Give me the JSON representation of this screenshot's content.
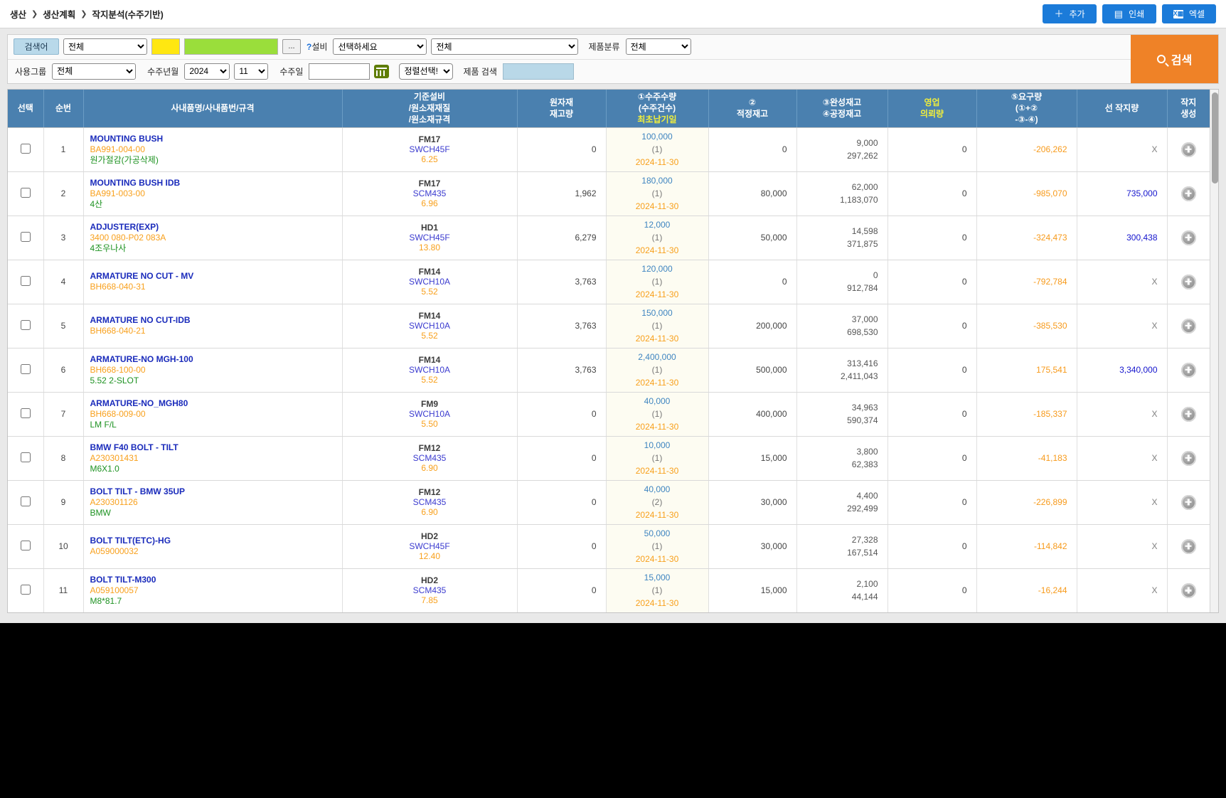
{
  "breadcrumb": {
    "items": [
      "생산",
      "생산계획",
      "작지분석(수주기반)"
    ]
  },
  "toolbar": {
    "add_label": "추가",
    "print_label": "인쇄",
    "excel_label": "엑셀"
  },
  "filters": {
    "keyword_label": "검색어",
    "keyword_type_value": "전체",
    "ellipsis_label": "...",
    "help_mark": "?",
    "equipment_label": "설비",
    "equipment_value": "선택하세요",
    "line_value": "전체",
    "product_class_label": "제품분류",
    "product_class_value": "전체",
    "usergroup_label": "사용그룹",
    "usergroup_value": "전체",
    "order_ym_label": "수주년월",
    "order_year_value": "2024",
    "order_month_value": "11",
    "order_date_label": "수주일",
    "order_date_value": "",
    "sort_value": "정렬선택!",
    "product_search_label": "제품 검색",
    "product_search_value": "",
    "search_button_label": "검색"
  },
  "columns": {
    "select": "선택",
    "seq": "순번",
    "item": "사내품명/사내품번/규격",
    "equip_l1": "기준설비",
    "equip_l2": "/원소재재질",
    "equip_l3": "/원소재규격",
    "raw_l1": "원자재",
    "raw_l2": "재고량",
    "order_l1": "①수주수량",
    "order_l2": "(수주건수)",
    "order_l3": "최초납기일",
    "proper_l1": "②",
    "proper_l2": "적정재고",
    "stock_l1": "③완성재고",
    "stock_l2": "④공정재고",
    "sales_l1": "영업",
    "sales_l2": "의뢰량",
    "req_l1": "⑤요구량",
    "req_l2": "(①+②",
    "req_l3": "-③-④)",
    "pre_work": "선 작지량",
    "gen_l1": "작지",
    "gen_l2": "생성"
  },
  "rows": [
    {
      "num": "1",
      "name": "MOUNTING BUSH",
      "part_no": "BA991-004-00",
      "spec": "원가절감(가공삭제)",
      "equipment": "FM17",
      "material": "SWCH45F",
      "material_spec": "6.25",
      "raw_stock": "0",
      "order_qty": "100,000",
      "order_count": "(1)",
      "due_date": "2024-11-30",
      "proper_stock": "0",
      "finished_stock": "9,000",
      "process_stock": "297,262",
      "sales_request": "0",
      "required_qty": "-206,262",
      "pre_work_qty": "X"
    },
    {
      "num": "2",
      "name": "MOUNTING BUSH IDB",
      "part_no": "BA991-003-00",
      "spec": "4산",
      "equipment": "FM17",
      "material": "SCM435",
      "material_spec": "6.96",
      "raw_stock": "1,962",
      "order_qty": "180,000",
      "order_count": "(1)",
      "due_date": "2024-11-30",
      "proper_stock": "80,000",
      "finished_stock": "62,000",
      "process_stock": "1,183,070",
      "sales_request": "0",
      "required_qty": "-985,070",
      "pre_work_qty": "735,000"
    },
    {
      "num": "3",
      "name": "ADJUSTER(EXP)",
      "part_no": "3400 080-P02 083A",
      "spec": "4조우나사",
      "equipment": "HD1",
      "material": "SWCH45F",
      "material_spec": "13.80",
      "raw_stock": "6,279",
      "order_qty": "12,000",
      "order_count": "(1)",
      "due_date": "2024-11-30",
      "proper_stock": "50,000",
      "finished_stock": "14,598",
      "process_stock": "371,875",
      "sales_request": "0",
      "required_qty": "-324,473",
      "pre_work_qty": "300,438"
    },
    {
      "num": "4",
      "name": "ARMATURE NO CUT - MV",
      "part_no": "BH668-040-31",
      "spec": "",
      "equipment": "FM14",
      "material": "SWCH10A",
      "material_spec": "5.52",
      "raw_stock": "3,763",
      "order_qty": "120,000",
      "order_count": "(1)",
      "due_date": "2024-11-30",
      "proper_stock": "0",
      "finished_stock": "0",
      "process_stock": "912,784",
      "sales_request": "0",
      "required_qty": "-792,784",
      "pre_work_qty": "X"
    },
    {
      "num": "5",
      "name": "ARMATURE NO CUT-IDB",
      "part_no": "BH668-040-21",
      "spec": "",
      "equipment": "FM14",
      "material": "SWCH10A",
      "material_spec": "5.52",
      "raw_stock": "3,763",
      "order_qty": "150,000",
      "order_count": "(1)",
      "due_date": "2024-11-30",
      "proper_stock": "200,000",
      "finished_stock": "37,000",
      "process_stock": "698,530",
      "sales_request": "0",
      "required_qty": "-385,530",
      "pre_work_qty": "X"
    },
    {
      "num": "6",
      "name": "ARMATURE-NO MGH-100",
      "part_no": "BH668-100-00",
      "spec": "5.52 2-SLOT",
      "equipment": "FM14",
      "material": "SWCH10A",
      "material_spec": "5.52",
      "raw_stock": "3,763",
      "order_qty": "2,400,000",
      "order_count": "(1)",
      "due_date": "2024-11-30",
      "proper_stock": "500,000",
      "finished_stock": "313,416",
      "process_stock": "2,411,043",
      "sales_request": "0",
      "required_qty": "175,541",
      "pre_work_qty": "3,340,000"
    },
    {
      "num": "7",
      "name": "ARMATURE-NO_MGH80",
      "part_no": "BH668-009-00",
      "spec": "LM F/L",
      "equipment": "FM9",
      "material": "SWCH10A",
      "material_spec": "5.50",
      "raw_stock": "0",
      "order_qty": "40,000",
      "order_count": "(1)",
      "due_date": "2024-11-30",
      "proper_stock": "400,000",
      "finished_stock": "34,963",
      "process_stock": "590,374",
      "sales_request": "0",
      "required_qty": "-185,337",
      "pre_work_qty": "X"
    },
    {
      "num": "8",
      "name": "BMW F40 BOLT - TILT",
      "part_no": "A230301431",
      "spec": "M6X1.0",
      "equipment": "FM12",
      "material": "SCM435",
      "material_spec": "6.90",
      "raw_stock": "0",
      "order_qty": "10,000",
      "order_count": "(1)",
      "due_date": "2024-11-30",
      "proper_stock": "15,000",
      "finished_stock": "3,800",
      "process_stock": "62,383",
      "sales_request": "0",
      "required_qty": "-41,183",
      "pre_work_qty": "X"
    },
    {
      "num": "9",
      "name": "BOLT TILT - BMW 35UP",
      "part_no": "A230301126",
      "spec": "BMW",
      "equipment": "FM12",
      "material": "SCM435",
      "material_spec": "6.90",
      "raw_stock": "0",
      "order_qty": "40,000",
      "order_count": "(2)",
      "due_date": "2024-11-30",
      "proper_stock": "30,000",
      "finished_stock": "4,400",
      "process_stock": "292,499",
      "sales_request": "0",
      "required_qty": "-226,899",
      "pre_work_qty": "X"
    },
    {
      "num": "10",
      "name": "BOLT TILT(ETC)-HG",
      "part_no": "A059000032",
      "spec": "",
      "equipment": "HD2",
      "material": "SWCH45F",
      "material_spec": "12.40",
      "raw_stock": "0",
      "order_qty": "50,000",
      "order_count": "(1)",
      "due_date": "2024-11-30",
      "proper_stock": "30,000",
      "finished_stock": "27,328",
      "process_stock": "167,514",
      "sales_request": "0",
      "required_qty": "-114,842",
      "pre_work_qty": "X"
    },
    {
      "num": "11",
      "name": "BOLT TILT-M300",
      "part_no": "A059100057",
      "spec": "M8*81.7",
      "equipment": "HD2",
      "material": "SCM435",
      "material_spec": "7.85",
      "raw_stock": "0",
      "order_qty": "15,000",
      "order_count": "(1)",
      "due_date": "2024-11-30",
      "proper_stock": "15,000",
      "finished_stock": "2,100",
      "process_stock": "44,144",
      "sales_request": "0",
      "required_qty": "-16,244",
      "pre_work_qty": "X"
    }
  ]
}
